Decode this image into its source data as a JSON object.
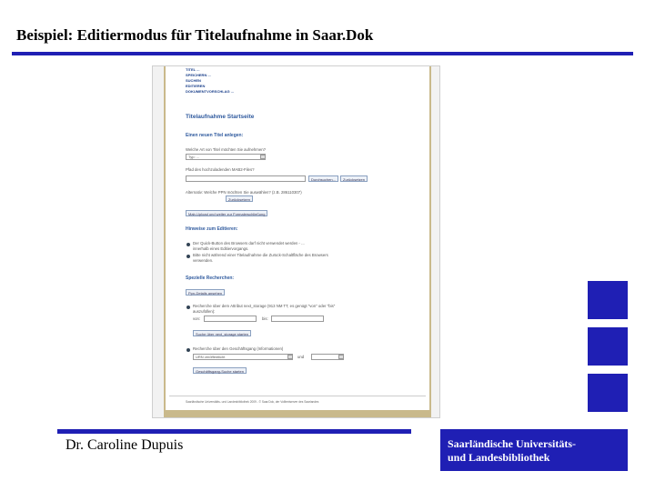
{
  "slide": {
    "title": "Beispiel: Editiermodus für Titelaufnahme in Saar.Dok",
    "author": "Dr. Caroline Dupuis",
    "institution_line1": "Saarländische Universitäts-",
    "institution_line2": "und Landesbibliothek",
    "accent_color": "#1f1fb4"
  },
  "screenshot": {
    "nav": [
      "TITEL ...",
      "SPEICHERN ...",
      "SUCHEN",
      "EDITIEREN",
      "DOKUMENTVORSCHLAG ..."
    ],
    "heading": "Titelaufnahme Startseite",
    "new_title": {
      "heading": "Einen neuen Titel anlegen:",
      "question": "Welche Art von Titel möchten Sie aufnehmen?",
      "select_value": "Typ: ..."
    },
    "path": {
      "label": "Pfad des hochzuladenden MAB2-Files?",
      "browse_button": "Durchsuchen...",
      "reset_button": "Zurücksetzen"
    },
    "alternativ": {
      "text": "Alternativ: Welche PPN möchten Sie auswählen? (z.B. 286110307)",
      "reset_button": "Zurücksetzen"
    },
    "upload_button": "Mab-Upload und weiter zur Formalerschließung",
    "hints": {
      "heading": "Hinweise zum Editieren:",
      "item1": "Der Quick-Button des Browsers darf nicht verwendet werden - ...",
      "item1_cont": "innerhalb eines Editiervorgangs.",
      "item2": "Bitte nicht während einer Titelaufnahme die Zurück-Schaltfläche des Browsers",
      "item2_cont": "verwenden."
    },
    "special": {
      "heading": "Spezielle Recherchen:",
      "ppn_button": "Ppn-Details ansehen",
      "next_storage": "Recherche über dem Attribut next_storage (913 NM TT, es genügt \"von\" oder \"bis\"",
      "next_storage_cont": "auszufüllen):",
      "von_label": "von:",
      "bis_label": "bis:",
      "next_storage_button": "Suche über next_storage starten",
      "business": "Recherche über den Geschäftsgang (Informationen)",
      "urn_select": "URN veröffentlicht",
      "und_label": "und",
      "business_button": "Geschäftsgang-Suche starten"
    },
    "footer": "Saarländische Universitäts- und Landesbibliothek 2009 - © Saar.Dok, der Volltextserver des Saarlandes"
  }
}
